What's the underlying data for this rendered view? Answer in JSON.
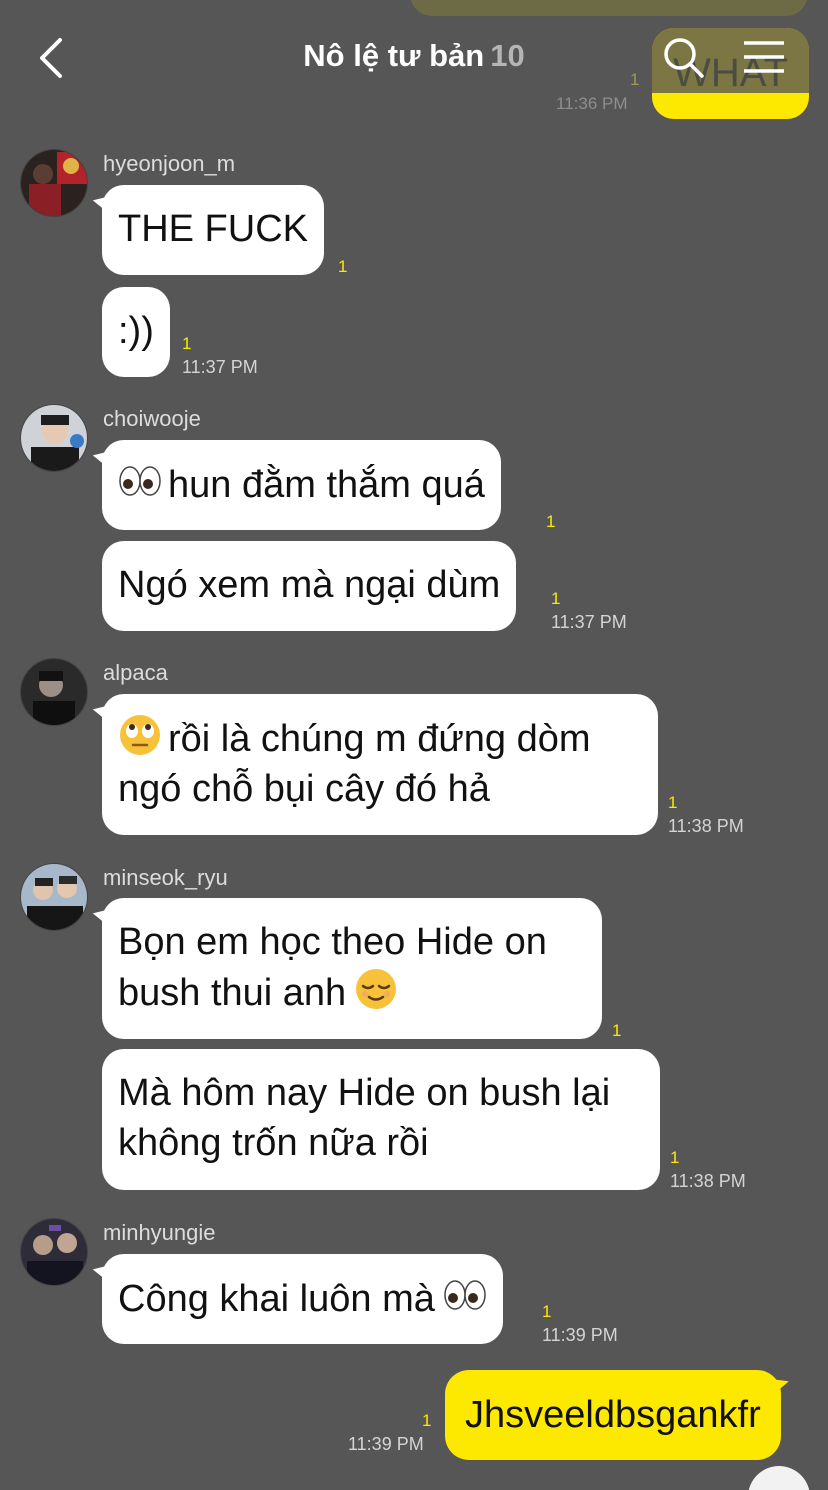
{
  "header": {
    "title": "Nô lệ tư bản",
    "member_count": "10",
    "back_icon": "chevron-left-icon",
    "search_icon": "search-icon",
    "menu_icon": "menu-icon"
  },
  "previous": {
    "my_text": "WHAT",
    "unread": "1",
    "time": "11:36 PM"
  },
  "colors": {
    "background": "#565656",
    "my_bubble": "#fde800",
    "other_bubble": "#ffffff",
    "unread": "#fde800"
  },
  "messages": [
    {
      "sender": "hyeonjoon_m",
      "bubbles": [
        {
          "text": "THE FUCK",
          "unread": "1"
        },
        {
          "text": ":))",
          "unread": "1",
          "time": "11:37 PM"
        }
      ]
    },
    {
      "sender": "choiwooje",
      "bubbles": [
        {
          "emoji": "eyes",
          "text": "hun đằm thắm quá",
          "unread": "1"
        },
        {
          "text": "Ngó xem mà ngại dùm",
          "unread": "1",
          "time": "11:37 PM"
        }
      ]
    },
    {
      "sender": "alpaca",
      "bubbles": [
        {
          "emoji": "rolling-eyes",
          "line1": "rồi là chúng m đứng dòm",
          "line2": "ngó chỗ bụi cây đó hả",
          "unread": "1",
          "time": "11:38 PM"
        }
      ]
    },
    {
      "sender": "minseok_ryu",
      "bubbles": [
        {
          "line1": "Bọn em học theo Hide on",
          "line2": "bush thui anh",
          "emoji": "relieved",
          "unread": "1"
        },
        {
          "line1": "Mà hôm nay Hide on bush lại",
          "line2": "không trốn nữa rồi",
          "unread": "1",
          "time": "11:38 PM"
        }
      ]
    },
    {
      "sender": "minhyungie",
      "bubbles": [
        {
          "text": "Công khai luôn mà",
          "emoji": "eyes",
          "unread": "1",
          "time": "11:39 PM"
        }
      ]
    }
  ],
  "my_last": {
    "text": "Jhsveeldbsgankfr",
    "unread": "1",
    "time": "11:39 PM"
  }
}
